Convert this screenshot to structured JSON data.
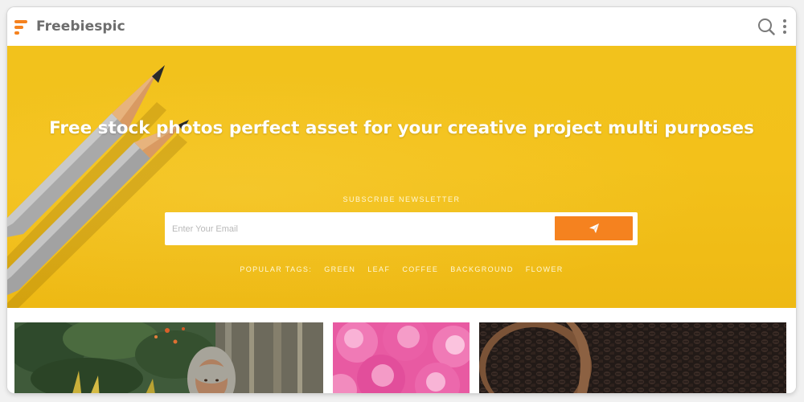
{
  "header": {
    "brand": "Freebiespic",
    "icons": [
      "freebiespic-logo-icon",
      "search-icon",
      "kebab-menu-icon"
    ]
  },
  "hero": {
    "title": "Free stock photos perfect asset for your creative project multi purposes",
    "subscribe_label": "SUBSCRIBE NEWSLETTER",
    "email_placeholder": "Enter Your Email",
    "send_icon": "paper-plane-icon",
    "tags_label": "POPULAR TAGS:",
    "tags": [
      "GREEN",
      "LEAF",
      "COFFEE",
      "BACKGROUND",
      "FLOWER"
    ]
  },
  "gallery": {
    "photos": [
      "woman-in-hijab-garden-photo",
      "pink-flowers-photo",
      "coffee-beans-photo"
    ]
  },
  "colors": {
    "brand_orange": "#f5821f",
    "hero_yellow": "#f2c21c",
    "logo_text": "#6d6d6d"
  }
}
